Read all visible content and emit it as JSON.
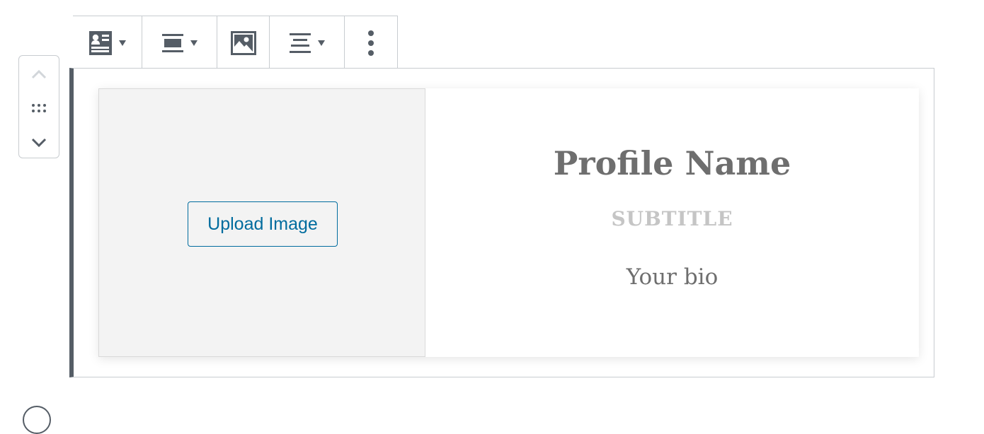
{
  "toolbar": {
    "items": [
      {
        "name": "change-block-type",
        "icon": "profile-card-icon",
        "has_dropdown": true
      },
      {
        "name": "change-alignment",
        "icon": "align-wide-icon",
        "has_dropdown": true
      },
      {
        "name": "edit-image",
        "icon": "image-icon",
        "has_dropdown": false
      },
      {
        "name": "change-text-alignment",
        "icon": "align-center-icon",
        "has_dropdown": true
      },
      {
        "name": "more-options",
        "icon": "more-vertical-icon",
        "has_dropdown": false
      }
    ]
  },
  "mover": {
    "up_icon": "chevron-up-icon",
    "drag_icon": "drag-handle-icon",
    "down_icon": "chevron-down-icon"
  },
  "profile": {
    "upload_label": "Upload Image",
    "name": "Profile Name",
    "subtitle": "SUBTITLE",
    "bio": "Your bio"
  },
  "colors": {
    "accent": "#006c9e",
    "toolbar_icon": "#555d66",
    "border": "#c8ccd0",
    "name_text": "#6e6e6e",
    "subtitle_text": "#c5c5c5",
    "media_bg": "#f3f3f3"
  }
}
